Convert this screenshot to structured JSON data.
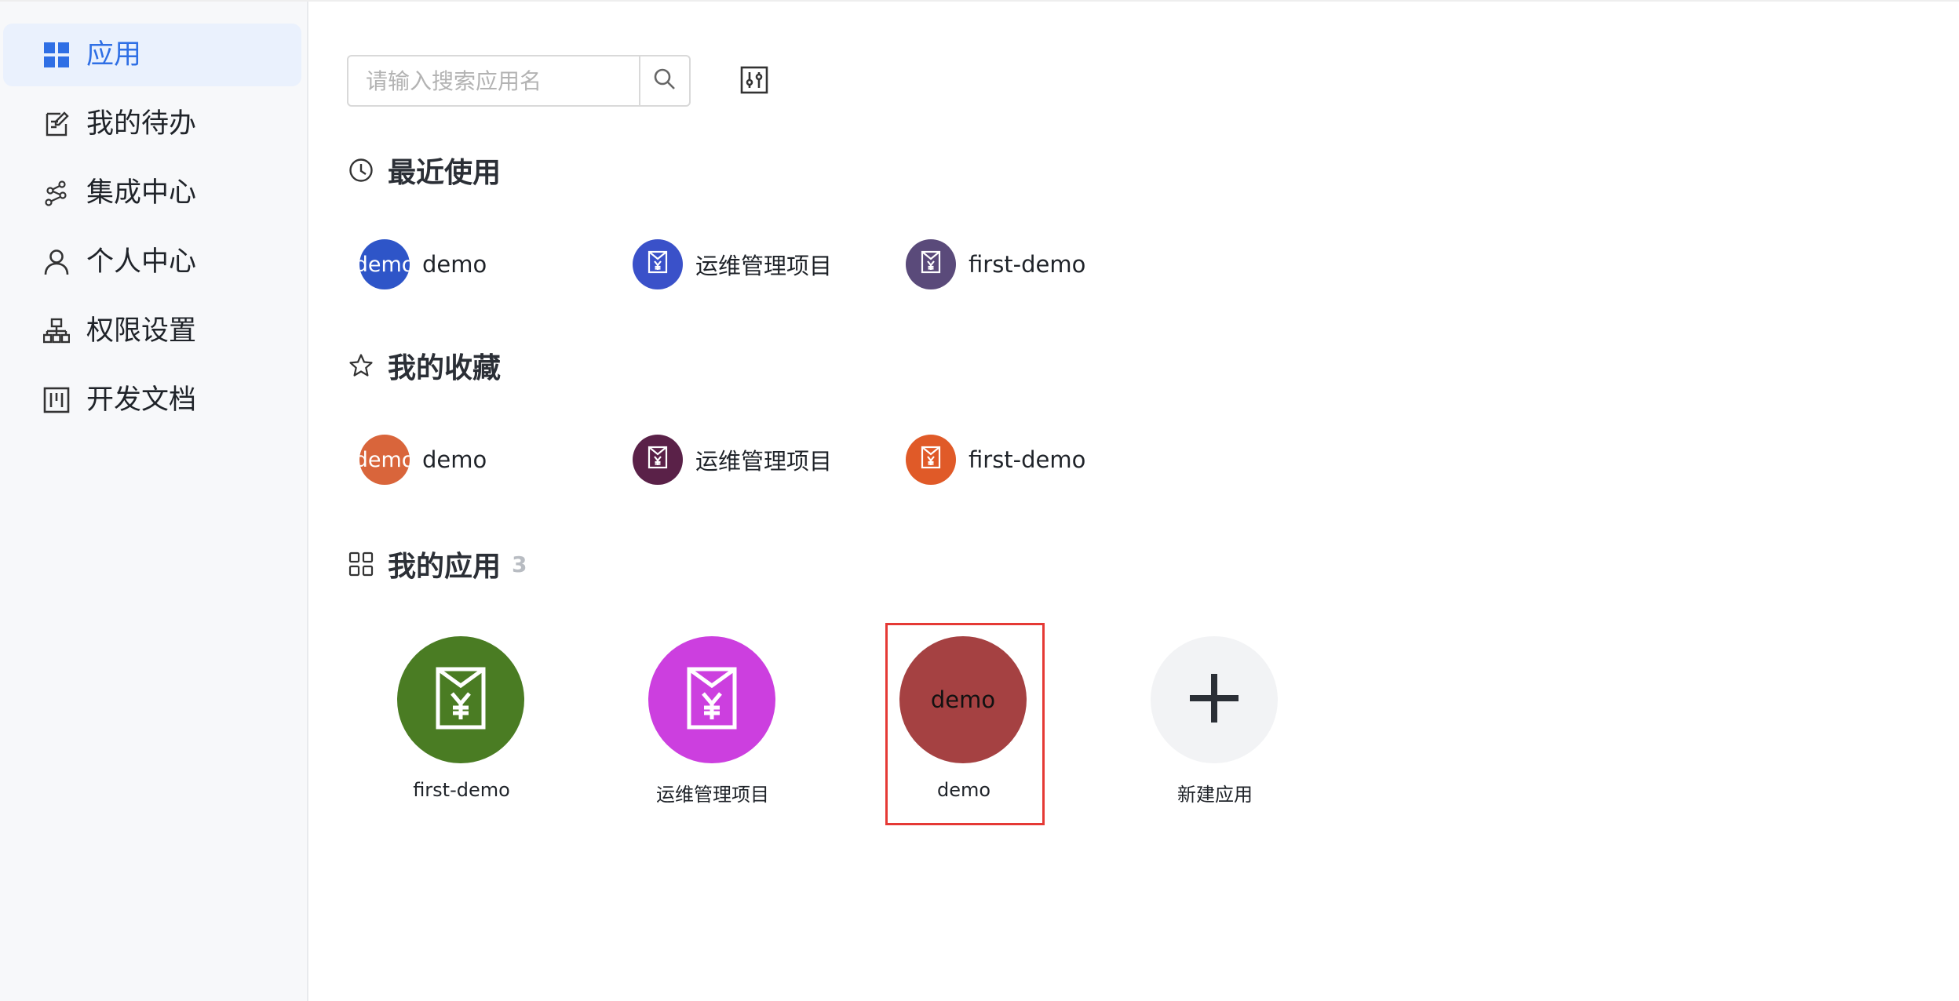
{
  "sidebar": {
    "items": [
      {
        "label": "应用",
        "icon": "grid-icon",
        "active": true
      },
      {
        "label": "我的待办",
        "icon": "todo-icon"
      },
      {
        "label": "集成中心",
        "icon": "integration-icon"
      },
      {
        "label": "个人中心",
        "icon": "user-icon"
      },
      {
        "label": "权限设置",
        "icon": "org-chart-icon"
      },
      {
        "label": "开发文档",
        "icon": "doc-board-icon"
      }
    ]
  },
  "toolbar": {
    "search_placeholder": "请输入搜索应用名",
    "search_icon": "search-icon",
    "filter_icon": "filter-settings-icon"
  },
  "recent": {
    "title": "最近使用",
    "icon": "clock-icon",
    "items": [
      {
        "label": "demo",
        "avatar_text": "demo",
        "color": "#2e55c8"
      },
      {
        "label": "运维管理项目",
        "icon": "bill-icon",
        "color": "#3a51c9"
      },
      {
        "label": "first-demo",
        "icon": "bill-icon",
        "color": "#5a4a7a"
      }
    ]
  },
  "favorites": {
    "title": "我的收藏",
    "icon": "star-icon",
    "items": [
      {
        "label": "demo",
        "avatar_text": "demo",
        "color": "#d9653b"
      },
      {
        "label": "运维管理项目",
        "icon": "bill-icon",
        "color": "#5a2148"
      },
      {
        "label": "first-demo",
        "icon": "bill-icon",
        "color": "#e05a28"
      }
    ]
  },
  "my_apps": {
    "title": "我的应用",
    "count": "3",
    "icon": "apps-grid-icon",
    "items": [
      {
        "label": "first-demo",
        "icon": "bill-icon",
        "color": "#4a7c23"
      },
      {
        "label": "运维管理项目",
        "icon": "bill-icon",
        "color": "#cc3fdf"
      },
      {
        "label": "demo",
        "avatar_text": "demo",
        "color": "#a54142",
        "selected": true
      }
    ],
    "new_app": {
      "label": "新建应用",
      "icon": "plus-icon",
      "color": "#f2f3f5"
    }
  }
}
